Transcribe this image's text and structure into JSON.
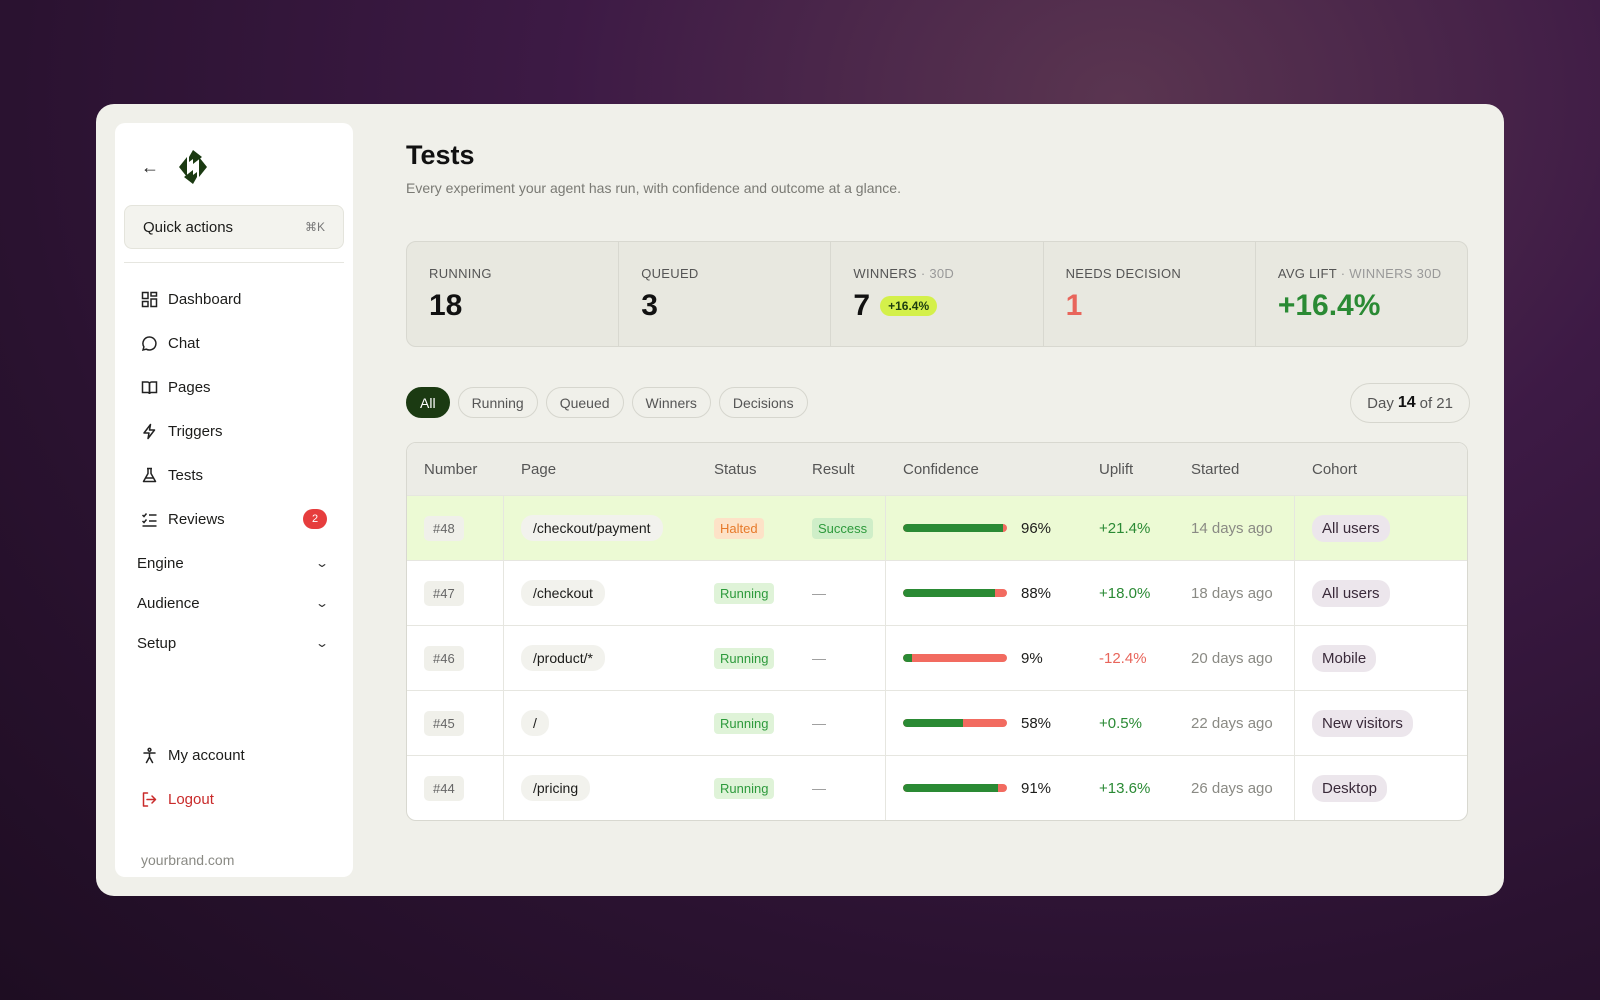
{
  "sidebar": {
    "quick_actions": {
      "label": "Quick actions",
      "shortcut": "⌘K"
    },
    "nav": [
      {
        "label": "Dashboard",
        "icon": "dashboard-icon"
      },
      {
        "label": "Chat",
        "icon": "chat-icon"
      },
      {
        "label": "Pages",
        "icon": "book-icon"
      },
      {
        "label": "Triggers",
        "icon": "lightning-icon"
      },
      {
        "label": "Tests",
        "icon": "flask-icon"
      },
      {
        "label": "Reviews",
        "icon": "checklist-icon",
        "badge": "2"
      }
    ],
    "sections": [
      "Engine",
      "Audience",
      "Setup"
    ],
    "account_label": "My account",
    "logout_label": "Logout",
    "domain": "yourbrand.com"
  },
  "header": {
    "title": "Tests",
    "subtitle": "Every experiment your agent has run, with confidence and outcome at a glance."
  },
  "stats": [
    {
      "label": "RUNNING",
      "value": "18"
    },
    {
      "label": "QUEUED",
      "value": "3"
    },
    {
      "label": "WINNERS",
      "label_suffix": "· 30D",
      "value": "7",
      "badge": "+16.4%"
    },
    {
      "label": "NEEDS DECISION",
      "value": "1"
    },
    {
      "label": "AVG LIFT",
      "label_suffix": "· WINNERS 30D",
      "value": "+16.4%"
    }
  ],
  "filters": [
    "All",
    "Running",
    "Queued",
    "Winners",
    "Decisions"
  ],
  "active_filter": "All",
  "day": {
    "prefix": "Day",
    "current": "14",
    "suffix": "of 21"
  },
  "table": {
    "headers": [
      "Number",
      "Page",
      "Status",
      "Result",
      "Confidence",
      "Uplift",
      "Started",
      "Cohort"
    ],
    "rows": [
      {
        "number": "#48",
        "page": "/checkout/payment",
        "status": "Halted",
        "result": "Success",
        "confidence": 96,
        "confidence_label": "96%",
        "uplift": "+21.4%",
        "started": "14 days ago",
        "cohort": "All users"
      },
      {
        "number": "#47",
        "page": "/checkout",
        "status": "Running",
        "result": "—",
        "confidence": 88,
        "confidence_label": "88%",
        "uplift": "+18.0%",
        "started": "18 days ago",
        "cohort": "All users"
      },
      {
        "number": "#46",
        "page": "/product/*",
        "status": "Running",
        "result": "—",
        "confidence": 9,
        "confidence_label": "9%",
        "uplift": "-12.4%",
        "started": "20 days ago",
        "cohort": "Mobile"
      },
      {
        "number": "#45",
        "page": "/",
        "status": "Running",
        "result": "—",
        "confidence": 58,
        "confidence_label": "58%",
        "uplift": "+0.5%",
        "started": "22 days ago",
        "cohort": "New visitors"
      },
      {
        "number": "#44",
        "page": "/pricing",
        "status": "Running",
        "result": "—",
        "confidence": 91,
        "confidence_label": "91%",
        "uplift": "+13.6%",
        "started": "26 days ago",
        "cohort": "Desktop"
      }
    ]
  },
  "colors": {
    "accent_dark": "#1b3a12",
    "positive": "#2a8a34",
    "negative": "#e8655b",
    "highlight_row": "#ecfad4"
  }
}
